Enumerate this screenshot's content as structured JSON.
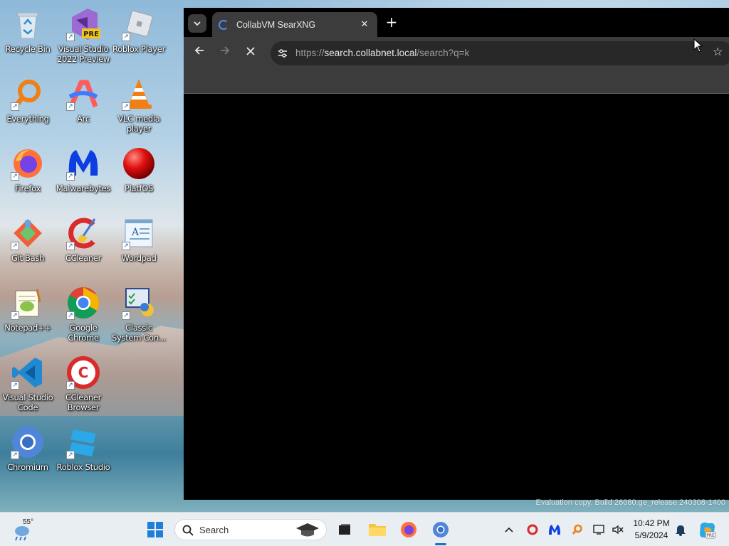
{
  "desktop": {
    "icons": [
      {
        "label": "Recycle Bin",
        "icon": "recycle-bin-icon"
      },
      {
        "label": "Visual Studio 2022 Preview",
        "icon": "visual-studio-icon",
        "badge": "PRE"
      },
      {
        "label": "Roblox Player",
        "icon": "roblox-player-icon"
      },
      {
        "label": "Everything",
        "icon": "everything-search-icon"
      },
      {
        "label": "Arc",
        "icon": "arc-icon"
      },
      {
        "label": "VLC media player",
        "icon": "vlc-icon"
      },
      {
        "label": "Firefox",
        "icon": "firefox-icon"
      },
      {
        "label": "Malwarebytes",
        "icon": "malwarebytes-icon"
      },
      {
        "label": "PlatfOS",
        "icon": "platfos-icon"
      },
      {
        "label": "Git Bash",
        "icon": "git-bash-icon"
      },
      {
        "label": "CCleaner",
        "icon": "ccleaner-icon"
      },
      {
        "label": "Wordpad",
        "icon": "wordpad-icon"
      },
      {
        "label": "Notepad++",
        "icon": "notepad-plus-plus-icon"
      },
      {
        "label": "Google Chrome",
        "icon": "chrome-icon"
      },
      {
        "label": "Classic System Con...",
        "icon": "control-panel-icon"
      },
      {
        "label": "Visual Studio Code",
        "icon": "vscode-icon"
      },
      {
        "label": "CCleaner Browser",
        "icon": "ccleaner-browser-icon"
      },
      {
        "label": "Chromium",
        "icon": "chromium-icon"
      },
      {
        "label": "Roblox Studio",
        "icon": "roblox-studio-icon"
      }
    ],
    "watermark": "Evaluation copy. Build 26080.ge_release.240308-1400"
  },
  "browser": {
    "tab": {
      "title": "CollabVM SearXNG",
      "favicon": "searxng-icon"
    },
    "url": {
      "scheme": "https://",
      "host": "search.collabnet.local",
      "path": "/search?q=k"
    },
    "state": "loading"
  },
  "taskbar": {
    "weather_temp": "55°",
    "search_placeholder": "Search",
    "clock_time": "10:42 PM",
    "clock_date": "5/9/2024"
  },
  "colors": {
    "taskbar_bg": "#e9eef2",
    "browser_toolbar": "#3c3c3c",
    "page_bg": "#000000",
    "accent": "#1a73c7"
  }
}
